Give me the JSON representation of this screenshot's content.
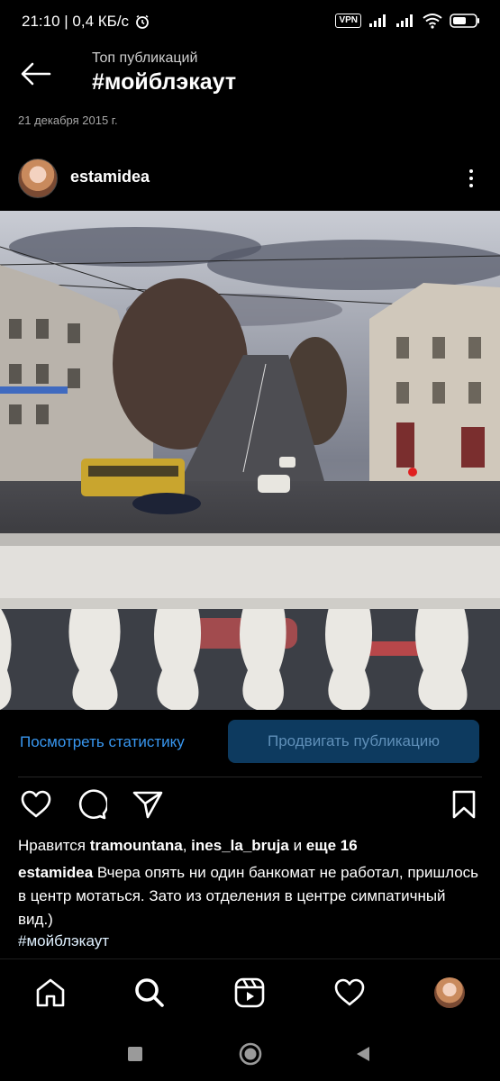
{
  "status_bar": {
    "time_info": "21:10 | 0,4 КБ/с",
    "vpn": "VPN"
  },
  "header": {
    "subtitle": "Топ публикаций",
    "title": "#мойблэкаут"
  },
  "post": {
    "date": "21 декабря 2015 г.",
    "author": "estamidea",
    "actions": {
      "stats_label": "Посмотреть статистику",
      "promote_label": "Продвигать публикацию"
    },
    "likes": {
      "prefix": "Нравится ",
      "user1": "tramountana",
      "sep": ", ",
      "user2": "ines_la_bruja",
      "and": " и ",
      "more": "еще 16"
    },
    "caption": {
      "user": "estamidea",
      "text": " Вчера опять ни один банкомат не работал, пришлось в центр мотаться. Зато из отделения в центре симпатичный вид.)"
    },
    "hashtag": "#мойблэкаут"
  },
  "colors": {
    "background": "#000000",
    "link_blue": "#3897f0",
    "promote_bg": "#0d3a5f"
  },
  "icons": {
    "back": "arrow-left-icon",
    "more": "more-vertical-icon",
    "like": "heart-icon",
    "comment": "comment-icon",
    "share": "send-icon",
    "save": "bookmark-icon",
    "nav": [
      "home-icon",
      "search-icon",
      "reels-icon",
      "heart-icon",
      "profile-avatar"
    ],
    "system": [
      "recents-square-icon",
      "home-circle-icon",
      "back-triangle-icon"
    ]
  }
}
